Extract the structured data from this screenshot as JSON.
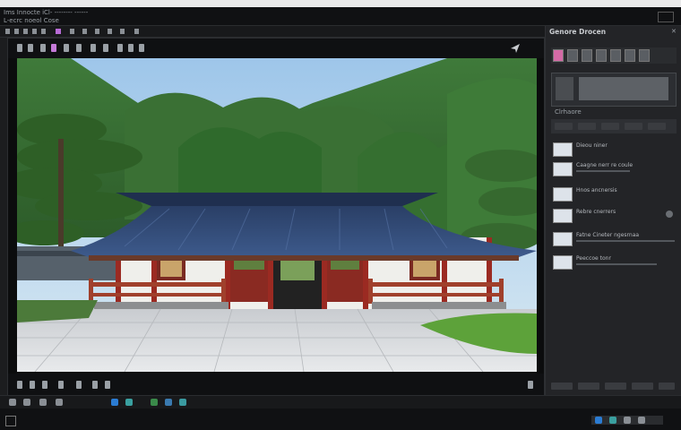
{
  "titlebar": {
    "line1": "Ims Innocte  iCl-  --------  ------",
    "line2": "L-ecrc noeol  Cose"
  },
  "panel": {
    "title": "Genore Drocen",
    "close": "✕",
    "layer_items": [
      {
        "label": "Dieou niner"
      },
      {
        "label": "Caagne  nerr  re  coule"
      },
      {
        "label": "Hnos  ancnersis"
      },
      {
        "label": "Rebre  cnerrers"
      },
      {
        "label": "Fatne  Cineter  ngesrnaa"
      },
      {
        "label": "Peeccoe  tonr"
      }
    ],
    "preview_label": "Clrhaore"
  },
  "viewer": {
    "tool_icons": [
      "move-icon",
      "crop-icon",
      "brush-icon",
      "eraser-icon",
      "text-icon",
      "shape-icon",
      "zoom-icon",
      "hand-icon",
      "eyedropper-icon",
      "lasso-icon",
      "rotate-icon"
    ],
    "cursor_icon": "pointer-icon"
  },
  "colors": {
    "accent": "#2b7cd3",
    "panel_bg": "#232427",
    "viewer_bg": "#0b0c0d"
  }
}
